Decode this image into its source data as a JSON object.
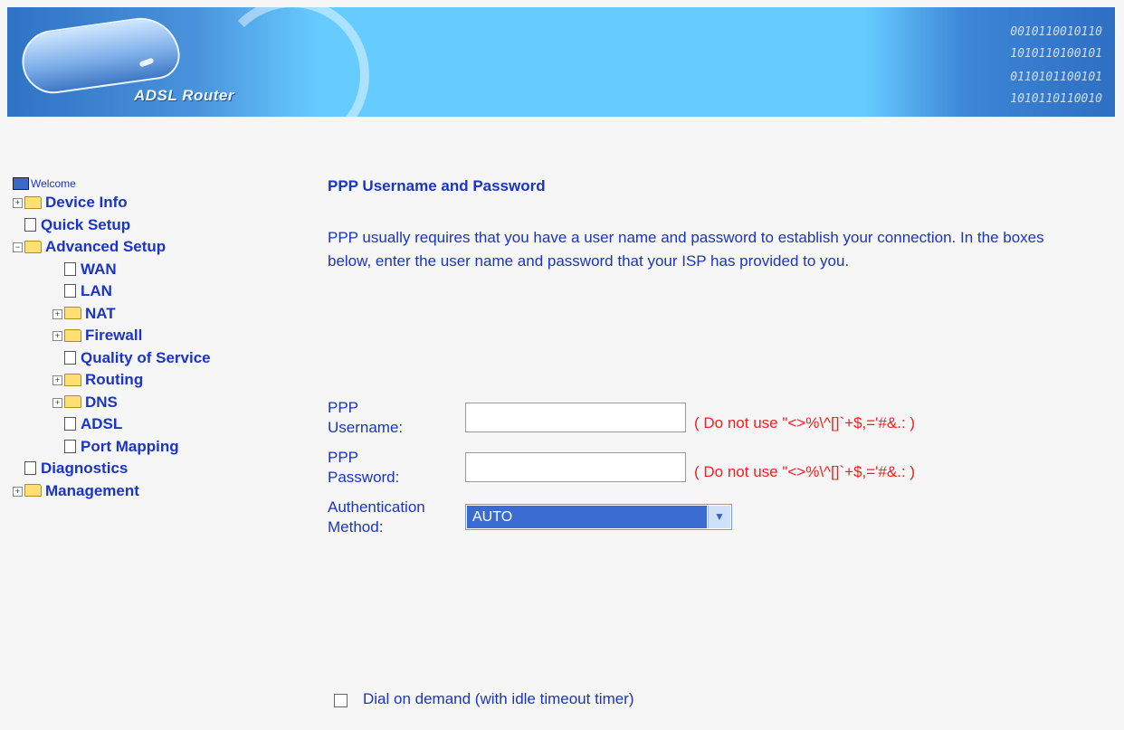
{
  "header": {
    "logo_text": "ADSL Router",
    "digits_line_1": "0010110010110",
    "digits_line_2": "1010110100101",
    "digits_line_3": "0110101100101",
    "digits_line_4": "1010110110010"
  },
  "sidebar": {
    "welcome": "Welcome",
    "device_info": "Device Info",
    "quick_setup": "Quick Setup",
    "advanced_setup": "Advanced Setup",
    "wan": "WAN",
    "lan": "LAN",
    "nat": "NAT",
    "firewall": "Firewall",
    "qos": "Quality of Service",
    "routing": "Routing",
    "dns": "DNS",
    "adsl": "ADSL",
    "port_mapping": "Port Mapping",
    "diagnostics": "Diagnostics",
    "management": "Management",
    "expand_symbol": "+",
    "collapse_symbol": "−"
  },
  "main": {
    "title": "PPP Username and Password",
    "description": "PPP usually requires that you have a user name and password to establish your connection. In the boxes below, enter the user name and password that your ISP has provided to you.",
    "username_label_1": "PPP",
    "username_label_2": "Username:",
    "username_value": "",
    "username_warning": "( Do not use \"<>%\\^[]`+$,='#&.: )",
    "password_label_1": "PPP",
    "password_label_2": "Password:",
    "password_value": "",
    "password_warning": "( Do not use \"<>%\\^[]`+$,='#&.: )",
    "auth_label_1": "Authentication",
    "auth_label_2": "Method:",
    "auth_value": "AUTO",
    "dial_on_demand_label": "Dial on demand (with idle timeout timer)"
  }
}
